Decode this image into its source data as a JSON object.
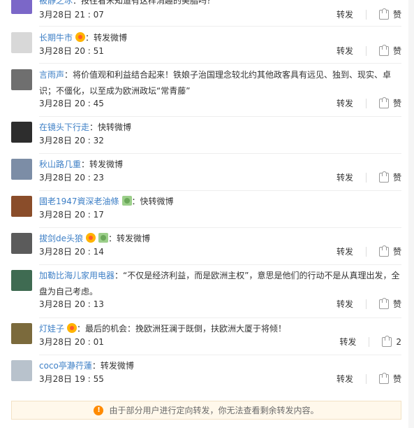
{
  "items": [
    {
      "user": "被静之冰",
      "text": "：按往看米知道有这样消趣的美脂吗？",
      "time": "3月28日 21 : 07",
      "forward_label": "转发",
      "like_label": "赞",
      "avatar_color": "#7b67c8",
      "badge": "",
      "member": false
    },
    {
      "user": "长期牛市",
      "text": "：转发微博",
      "time": "3月28日 20 : 51",
      "forward_label": "转发",
      "like_label": "赞",
      "avatar_color": "#d8d8d8",
      "badge": "vip",
      "member": false
    },
    {
      "user": "言雨声",
      "text": "：将价值观和利益结合起来！铁娘子治国理念较北约其他政客具有远见、独到、现实、卓识；不僵化，以至成为欧洲政坛“常青藤”",
      "time": "3月28日 20 : 45",
      "forward_label": "转发",
      "like_label": "赞",
      "avatar_color": "#6f6f6f",
      "badge": "",
      "member": false
    },
    {
      "user": "在镜头下行走",
      "text": "：快转微博",
      "time": "3月28日 20 : 32",
      "forward_label": "",
      "like_label": "",
      "avatar_color": "#2d2d2d",
      "badge": "",
      "member": false
    },
    {
      "user": "秋山路几重",
      "text": "：转发微博",
      "time": "3月28日 20 : 23",
      "forward_label": "转发",
      "like_label": "赞",
      "avatar_color": "#7c8da6",
      "badge": "",
      "member": false
    },
    {
      "user": "國老1947資深老油條",
      "text": "：快转微博",
      "time": "3月28日 20 : 17",
      "forward_label": "",
      "like_label": "",
      "avatar_color": "#8a4d2a",
      "badge": "",
      "member": true
    },
    {
      "user": "拔剑de头狼",
      "text": "：转发微博",
      "time": "3月28日 20 : 14",
      "forward_label": "转发",
      "like_label": "赞",
      "avatar_color": "#5b5b5b",
      "badge": "vip",
      "member": true
    },
    {
      "user": "加勒比海儿家用电器",
      "text": "：“不仅是经济利益，而是欧洲主权”，意思是他们的行动不是从真理出发，全盘为自己考虑。",
      "time": "3月28日 20 : 13",
      "forward_label": "转发",
      "like_label": "赞",
      "avatar_color": "#3f6b52",
      "badge": "",
      "member": false
    },
    {
      "user": "灯娃子",
      "text": "：最后的机会：挽欧洲狂澜于既倒，扶欧洲大厦于将倾！",
      "time": "3月28日 20 : 01",
      "forward_label": "转发",
      "like_label": "2",
      "avatar_color": "#7b6a3c",
      "badge": "vip",
      "member": false
    },
    {
      "user": "coco亭瀞荇蓮",
      "text": "：转发微博",
      "time": "3月28日 19 : 55",
      "forward_label": "转发",
      "like_label": "赞",
      "avatar_color": "#b8c2cc",
      "badge": "",
      "member": false
    }
  ],
  "notice": {
    "text": "由于部分用户进行定向转发，你无法查看剩余转发内容。",
    "icon": "!"
  }
}
